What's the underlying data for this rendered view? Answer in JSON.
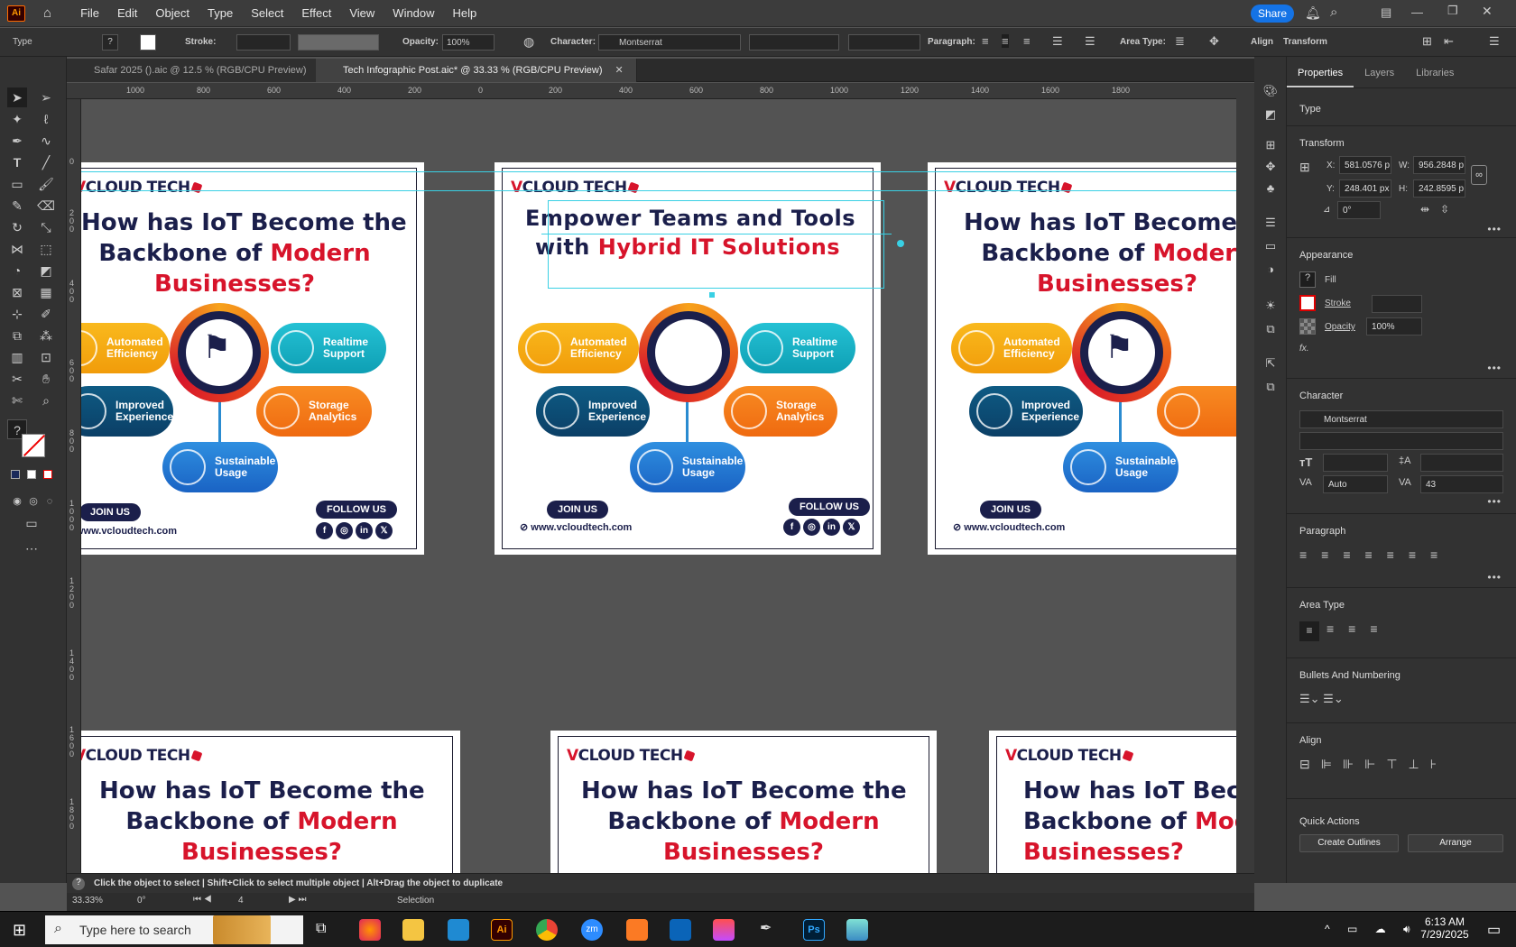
{
  "app": {
    "logo": "Ai",
    "menus": [
      "File",
      "Edit",
      "Object",
      "Type",
      "Select",
      "Effect",
      "View",
      "Window",
      "Help"
    ],
    "share": "Share"
  },
  "control": {
    "type_label": "Type",
    "stroke_label": "Stroke:",
    "opacity_label": "Opacity:",
    "opacity_value": "100%",
    "character_label": "Character:",
    "font": "Montserrat",
    "paragraph_label": "Paragraph:",
    "area_type_label": "Area Type:",
    "align_label": "Align",
    "transform_label": "Transform"
  },
  "tabs": [
    {
      "label": "Safar 2025 ().aic @ 12.5 % (RGB/CPU Preview)"
    },
    {
      "label": "Tech Infographic Post.aic* @ 33.33 % (RGB/CPU Preview)"
    }
  ],
  "ruler_h": [
    "1000",
    "800",
    "600",
    "400",
    "200",
    "0",
    "200",
    "400",
    "600",
    "800",
    "1000",
    "1200",
    "1400",
    "1600",
    "1800"
  ],
  "ruler_v": [
    "0",
    "2 0 0",
    "4 0 0",
    "6 0 0",
    "8 0 0",
    "1 0 0 0",
    "1 2 0 0",
    "1 4 0 0",
    "1 6 0 0",
    "1 8 0 0"
  ],
  "post": {
    "brand_v": "V",
    "brand_rest": "CLOUD TECH",
    "q_line1": "How has IoT Become the",
    "q_line2a": "Backbone of ",
    "q_line2b": "Modern",
    "q_line3": "Businesses?",
    "e_line1": "Empower Teams and Tools",
    "e_line2a": "with ",
    "e_line2b": "Hybrid IT Solutions",
    "auto": "Automated\nEfficiency",
    "real": "Realtime\nSupport",
    "improved": "Improved\nExperience",
    "storage": "Storage\nAnalytics",
    "sust": "Sustainable\nUsage",
    "join": "JOIN US",
    "follow": "FOLLOW US",
    "website": "www.vcloudtech.com",
    "socials": [
      "f",
      "◎",
      "in",
      "𝕏"
    ]
  },
  "status": {
    "hint": "Click the object to select  |  Shift+Click to select multiple object  |  Alt+Drag the object to duplicate",
    "zoom": "33.33%",
    "angle": "0°",
    "artboard": "4",
    "tool": "Selection"
  },
  "props": {
    "tabs": [
      "Properties",
      "Layers",
      "Libraries"
    ],
    "type": "Type",
    "transform": "Transform",
    "x_label": "X:",
    "x": "581.0576 p",
    "y_label": "Y:",
    "y": "248.401 px",
    "w_label": "W:",
    "w": "956.2848 p",
    "h_label": "H:",
    "h": "242.8595 p",
    "angle": "0°",
    "appearance": "Appearance",
    "fill": "Fill",
    "stroke": "Stroke",
    "opacity": "Opacity",
    "opacity_value": "100%",
    "fx": "fx.",
    "character": "Character",
    "font": "Montserrat",
    "leading": "Auto",
    "tracking": "43",
    "paragraph": "Paragraph",
    "area_type": "Area Type",
    "bullets": "Bullets And Numbering",
    "align": "Align",
    "quick_actions": "Quick Actions",
    "create_outlines": "Create Outlines",
    "arrange": "Arrange"
  },
  "taskbar": {
    "search": "Type here to search",
    "time": "6:13 AM",
    "date": "7/29/2025"
  }
}
